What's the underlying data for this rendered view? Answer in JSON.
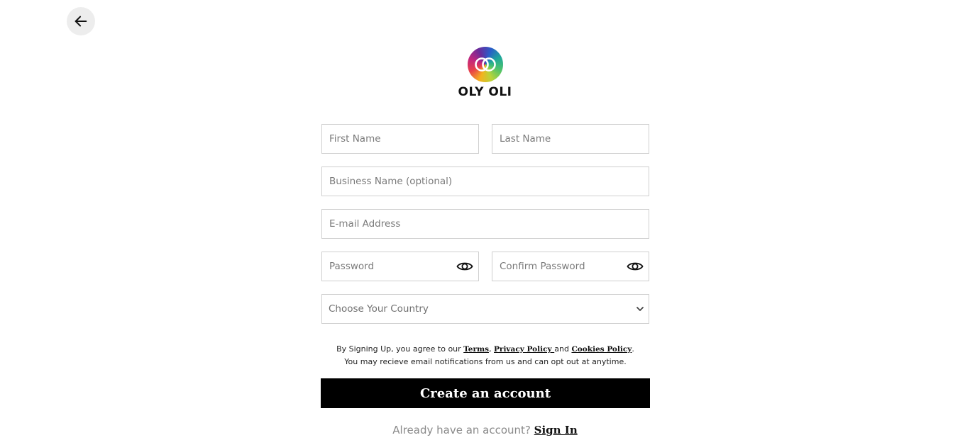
{
  "header": {
    "back_icon": "arrow-left-icon"
  },
  "brand": {
    "name": "OLY OLI",
    "logo_icon": "interlocking-rings-logo"
  },
  "form": {
    "first_name": {
      "value": "",
      "placeholder": "First Name"
    },
    "last_name": {
      "value": "",
      "placeholder": "Last Name"
    },
    "business_name": {
      "value": "",
      "placeholder": "Business Name (optional)"
    },
    "email": {
      "value": "",
      "placeholder": "E-mail Address"
    },
    "password": {
      "value": "",
      "placeholder": "Password",
      "toggle_icon": "eye-icon"
    },
    "confirm_password": {
      "value": "",
      "placeholder": "Confirm Password",
      "toggle_icon": "eye-icon"
    },
    "country": {
      "selected": "Choose Your Country",
      "icon": "chevron-down-icon"
    }
  },
  "terms": {
    "prefix": "By Signing Up, you agree to our ",
    "terms_link": "Terms",
    "comma": ", ",
    "privacy_link": "Privacy Policy ",
    "and": "and ",
    "cookies_link": "Cookies Policy",
    "period": ".",
    "line2": "You may recieve email notifications from us and can opt out at anytime."
  },
  "actions": {
    "create_label": "Create an account",
    "signin_prompt": "Already have an account? ",
    "signin_link": "Sign In"
  },
  "colors": {
    "primary_button": "#000000",
    "field_border": "#cfcfcf",
    "back_button_bg": "#ededed"
  }
}
